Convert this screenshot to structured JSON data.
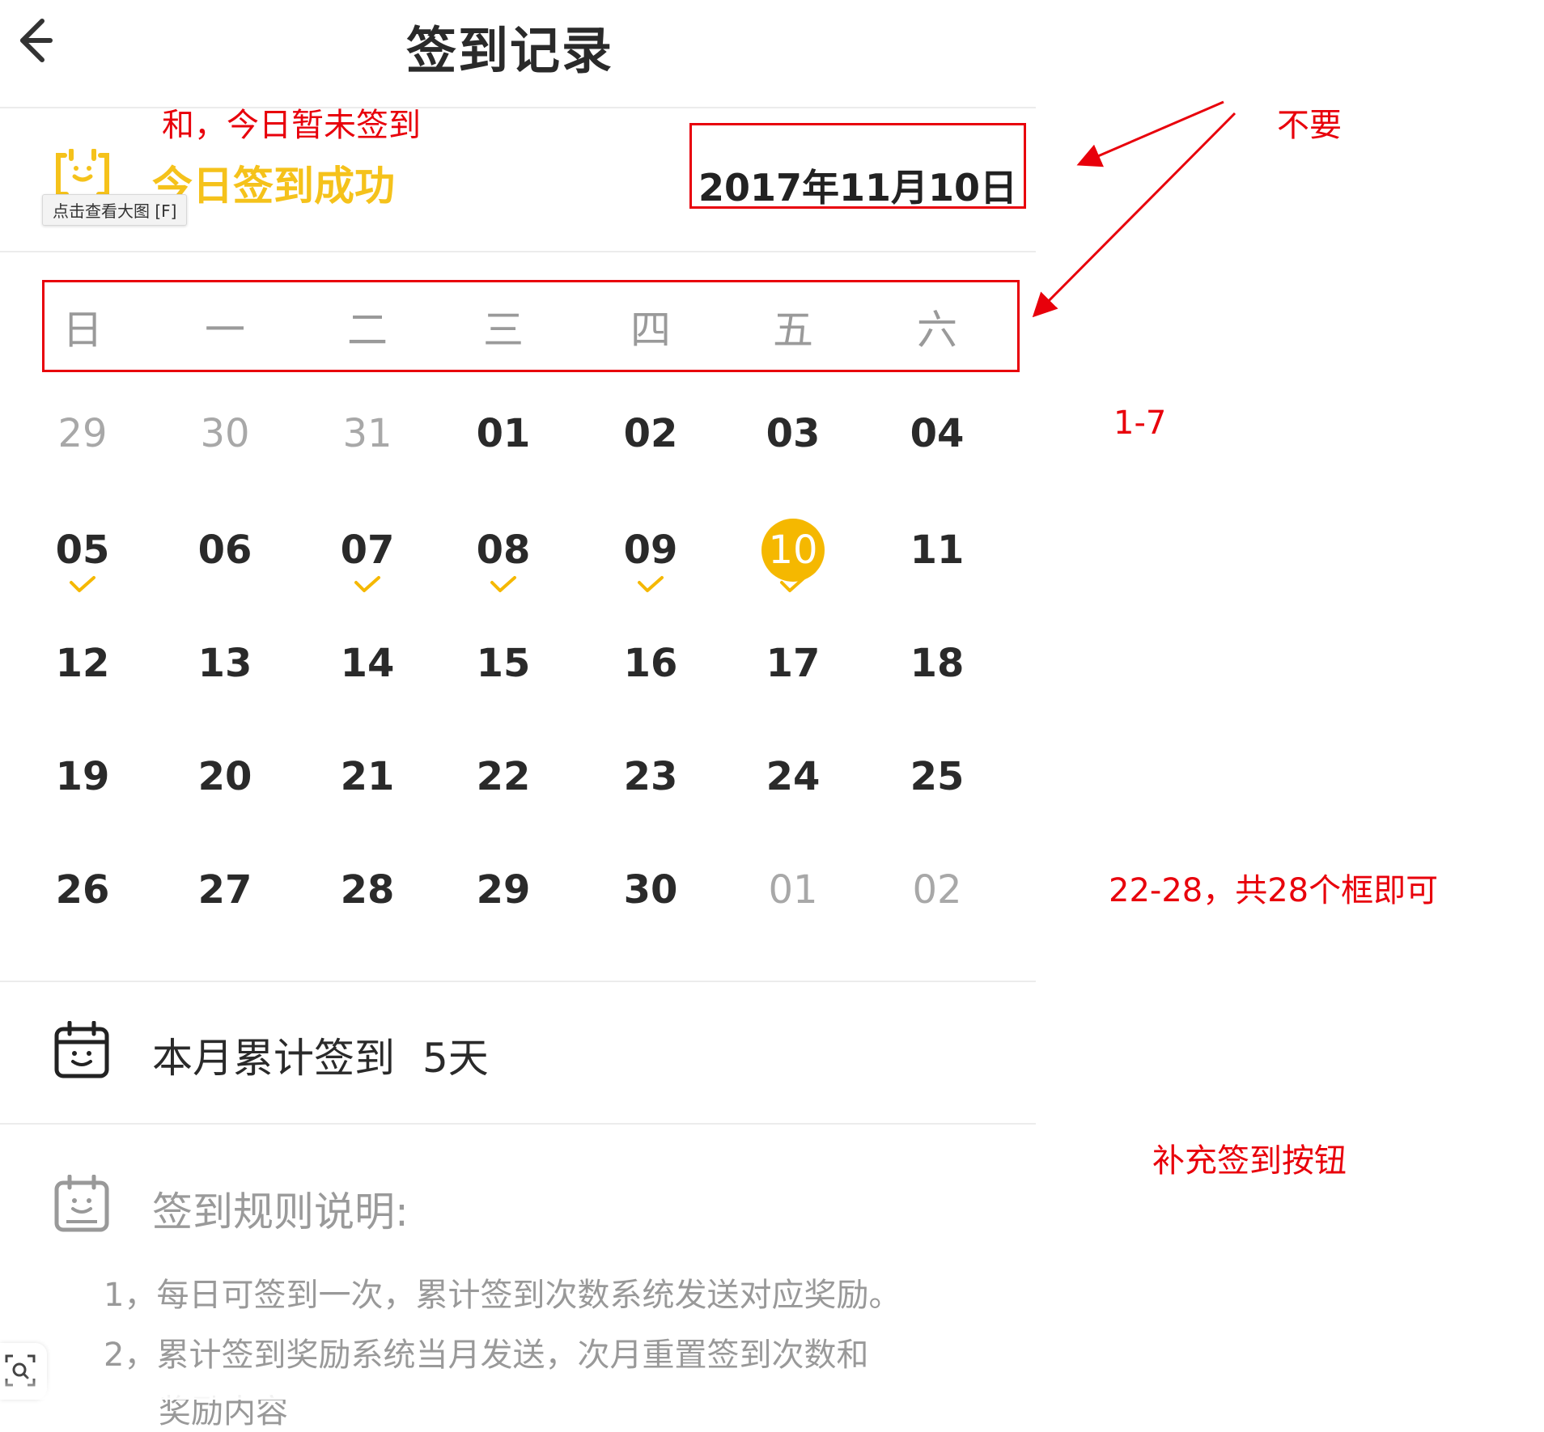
{
  "header": {
    "title": "签到记录",
    "back_icon": "chevron-left-icon"
  },
  "today": {
    "status_text": "今日签到成功",
    "tooltip": "点击查看大图 [F]",
    "date": "2017年11月10日"
  },
  "weekdays": [
    "日",
    "一",
    "二",
    "三",
    "四",
    "五",
    "六"
  ],
  "calendar": {
    "rows": [
      [
        {
          "d": "29",
          "other": true
        },
        {
          "d": "30",
          "other": true
        },
        {
          "d": "31",
          "other": true
        },
        {
          "d": "01"
        },
        {
          "d": "02"
        },
        {
          "d": "03"
        },
        {
          "d": "04"
        }
      ],
      [
        {
          "d": "05",
          "checked": true
        },
        {
          "d": "06"
        },
        {
          "d": "07",
          "checked": true
        },
        {
          "d": "08",
          "checked": true
        },
        {
          "d": "09",
          "checked": true
        },
        {
          "d": "10",
          "checked": true,
          "today": true
        },
        {
          "d": "11"
        }
      ],
      [
        {
          "d": "12"
        },
        {
          "d": "13"
        },
        {
          "d": "14"
        },
        {
          "d": "15"
        },
        {
          "d": "16"
        },
        {
          "d": "17"
        },
        {
          "d": "18"
        }
      ],
      [
        {
          "d": "19"
        },
        {
          "d": "20"
        },
        {
          "d": "21"
        },
        {
          "d": "22"
        },
        {
          "d": "23"
        },
        {
          "d": "24"
        },
        {
          "d": "25"
        }
      ],
      [
        {
          "d": "26"
        },
        {
          "d": "27"
        },
        {
          "d": "28"
        },
        {
          "d": "29"
        },
        {
          "d": "30"
        },
        {
          "d": "01",
          "other": true
        },
        {
          "d": "02",
          "other": true
        }
      ]
    ]
  },
  "summary": {
    "label": "本月累计签到",
    "count": "5天"
  },
  "rules": {
    "title": "签到规则说明:",
    "lines": [
      "1，每日可签到一次，累计签到次数系统发送对应奖励。",
      "2，累计签到奖励系统当月发送，次月重置签到次数和",
      "奖励内容"
    ]
  },
  "annotations": {
    "status_note": "和，今日暂未签到",
    "remove_note": "不要",
    "range_note_1": "1-7",
    "range_note_2": "22-28，共28个框即可",
    "button_note": "补充签到按钮"
  },
  "colors": {
    "accent": "#f5b800",
    "annotation": "#e8000b",
    "muted": "#a8a8a8"
  }
}
